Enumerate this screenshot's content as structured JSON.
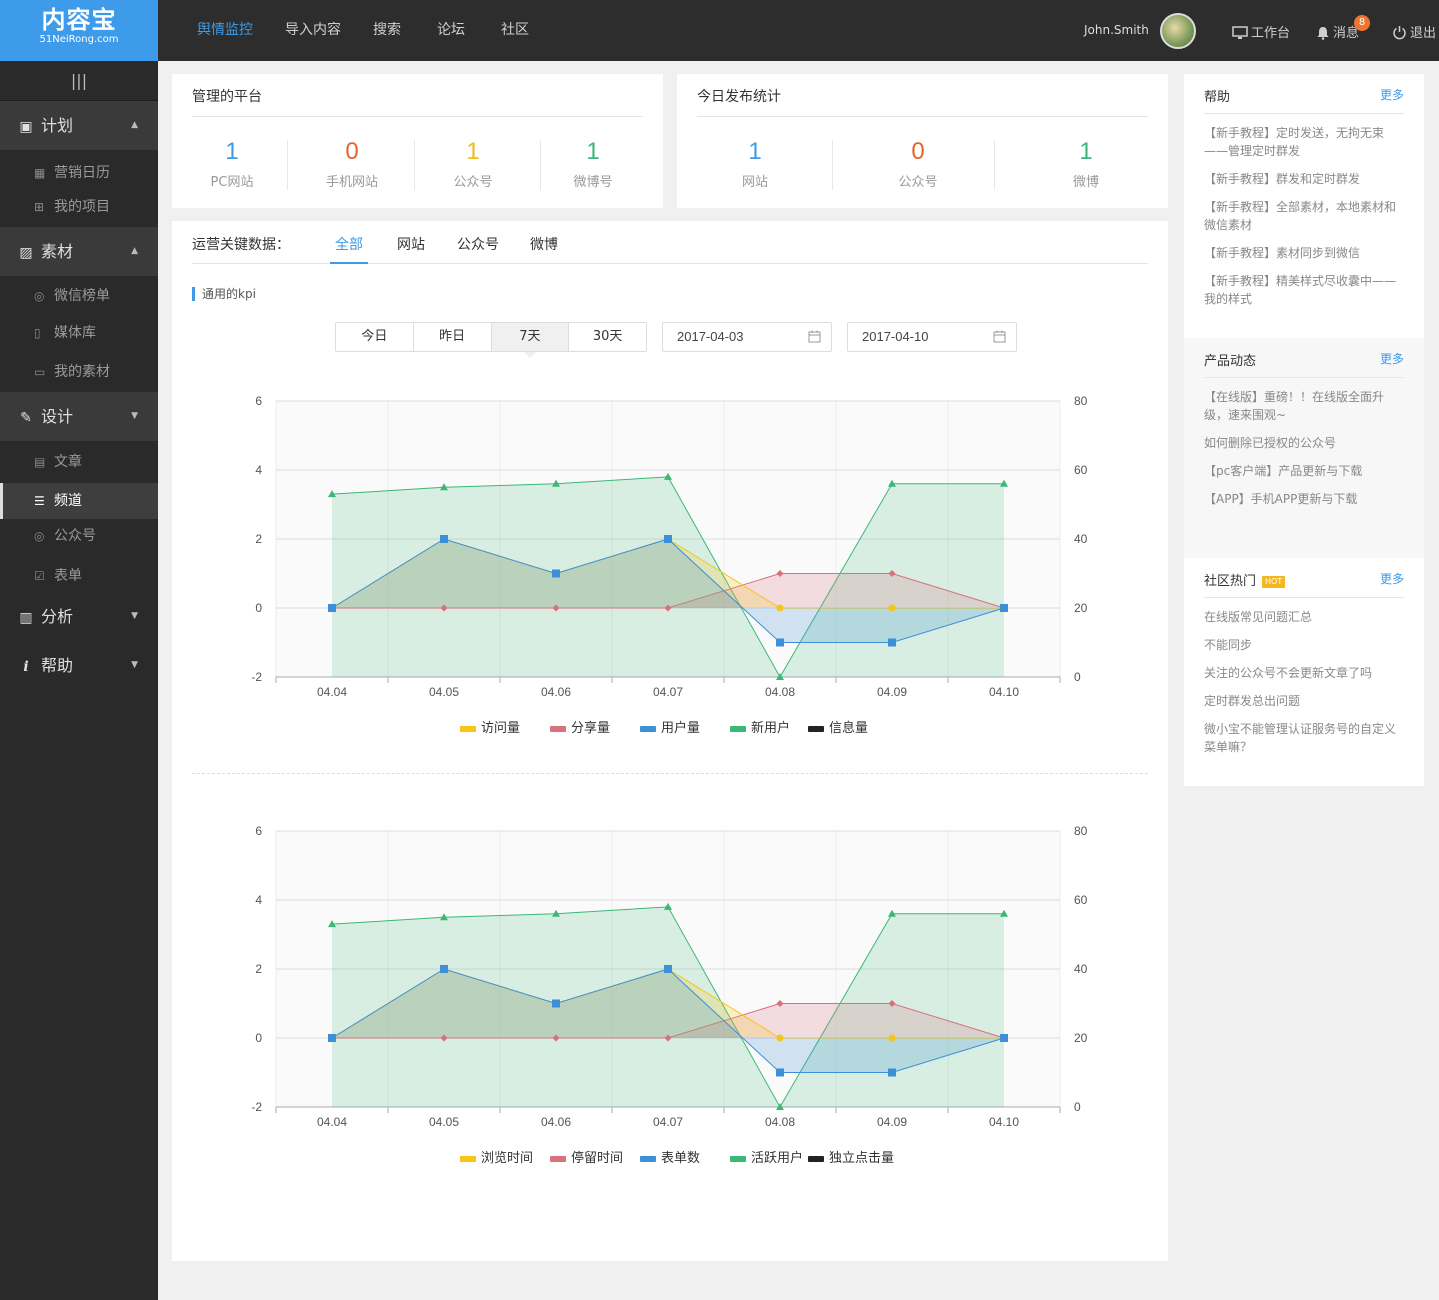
{
  "logo": {
    "title": "内容宝",
    "sub": "51NeiRong.com"
  },
  "nav": [
    "舆情监控",
    "导入内容",
    "搜索",
    "论坛",
    "社区"
  ],
  "user": {
    "name": "John.Smith",
    "workbench": "工作台",
    "messages": "消息",
    "badge": "8",
    "logout": "退出"
  },
  "sidebar": {
    "toggle": "|||",
    "sections": [
      {
        "label": "计划",
        "items": [
          "营销日历",
          "我的项目"
        ]
      },
      {
        "label": "素材",
        "items": [
          "微信榜单",
          "媒体库",
          "我的素材"
        ]
      },
      {
        "label": "设计",
        "items": [
          "文章",
          "频道",
          "公众号",
          "表单"
        ]
      },
      {
        "label": "分析",
        "items": []
      },
      {
        "label": "帮助",
        "items": []
      }
    ]
  },
  "platform": {
    "title": "管理的平台",
    "stats": [
      {
        "value": "1",
        "label": "PC网站",
        "color": "#3d9be9"
      },
      {
        "value": "0",
        "label": "手机网站",
        "color": "#e8632b"
      },
      {
        "value": "1",
        "label": "公众号",
        "color": "#f5b81c"
      },
      {
        "value": "1",
        "label": "微博号",
        "color": "#3bb877"
      }
    ]
  },
  "today": {
    "title": "今日发布统计",
    "stats": [
      {
        "value": "1",
        "label": "网站",
        "color": "#3d9be9"
      },
      {
        "value": "0",
        "label": "公众号",
        "color": "#e8632b"
      },
      {
        "value": "1",
        "label": "微博",
        "color": "#3bb877"
      }
    ]
  },
  "ops": {
    "label": "运营关键数据：",
    "tabs": [
      "全部",
      "网站",
      "公众号",
      "微博"
    ]
  },
  "kpi_label": "通用的kpi",
  "ranges": [
    "今日",
    "昨日",
    "7天",
    "30天"
  ],
  "date_from": "2017-04-03",
  "date_to": "2017-04-10",
  "chart_data": [
    {
      "type": "line",
      "x": [
        "04.04",
        "04.05",
        "04.06",
        "04.07",
        "04.08",
        "04.09",
        "04.10"
      ],
      "ylim": [
        -2,
        6
      ],
      "yticks": [
        -2,
        0,
        2,
        4,
        6
      ],
      "y2lim": [
        0,
        80
      ],
      "y2ticks": [
        0,
        20,
        40,
        60,
        80
      ],
      "grid": true,
      "legend": "bottom",
      "series": [
        {
          "name": "访问量",
          "axis": "left",
          "color": "#f5c518",
          "values": [
            0,
            2,
            1,
            2,
            0,
            0,
            0
          ]
        },
        {
          "name": "分享量",
          "axis": "left",
          "color": "#d9707e",
          "values": [
            0,
            0,
            0,
            0,
            1,
            1,
            0
          ]
        },
        {
          "name": "用户量",
          "axis": "left",
          "color": "#3d8fd6",
          "values": [
            0,
            2,
            1,
            2,
            -1,
            -1,
            0
          ]
        },
        {
          "name": "新用户",
          "axis": "right",
          "color": "#3bb877",
          "values": [
            53,
            55,
            56,
            58,
            0,
            56,
            56
          ]
        },
        {
          "name": "信息量",
          "axis": "left",
          "color": "#222222",
          "values": []
        }
      ]
    },
    {
      "type": "line",
      "x": [
        "04.04",
        "04.05",
        "04.06",
        "04.07",
        "04.08",
        "04.09",
        "04.10"
      ],
      "ylim": [
        -2,
        6
      ],
      "yticks": [
        -2,
        0,
        2,
        4,
        6
      ],
      "y2lim": [
        0,
        80
      ],
      "y2ticks": [
        0,
        20,
        40,
        60,
        80
      ],
      "grid": true,
      "legend": "bottom",
      "series": [
        {
          "name": "浏览时间",
          "axis": "left",
          "color": "#f5c518",
          "values": [
            0,
            2,
            1,
            2,
            0,
            0,
            0
          ]
        },
        {
          "name": "停留时间",
          "axis": "left",
          "color": "#d9707e",
          "values": [
            0,
            0,
            0,
            0,
            1,
            1,
            0
          ]
        },
        {
          "name": "表单数",
          "axis": "left",
          "color": "#3d8fd6",
          "values": [
            0,
            2,
            1,
            2,
            -1,
            -1,
            0
          ]
        },
        {
          "name": "活跃用户",
          "axis": "right",
          "color": "#3bb877",
          "values": [
            53,
            55,
            56,
            58,
            0,
            56,
            56
          ]
        },
        {
          "name": "独立点击量",
          "axis": "left",
          "color": "#222222",
          "values": []
        }
      ]
    }
  ],
  "help": {
    "title": "帮助",
    "more": "更多",
    "links": [
      "【新手教程】定时发送，无拘无束——管理定时群发",
      "【新手教程】群发和定时群发",
      "【新手教程】全部素材，本地素材和微信素材",
      "【新手教程】素材同步到微信",
      "【新手教程】精美样式尽收囊中——我的样式"
    ]
  },
  "news": {
    "title": "产品动态",
    "more": "更多",
    "links": [
      "【在线版】重磅！！在线版全面升级，速来围观~",
      "如何删除已授权的公众号",
      "【pc客户端】产品更新与下载",
      "【APP】手机APP更新与下载"
    ]
  },
  "community": {
    "title": "社区热门",
    "hot": "HOT",
    "more": "更多",
    "links": [
      "在线版常见问题汇总",
      "不能同步",
      "关注的公众号不会更新文章了吗",
      "定时群发总出问题",
      "微小宝不能管理认证服务号的自定义菜单嘛？"
    ]
  }
}
